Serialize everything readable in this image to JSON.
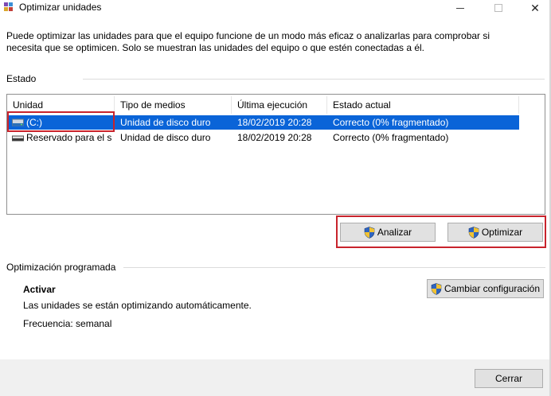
{
  "window": {
    "title": "Optimizar unidades"
  },
  "description": "Puede optimizar las unidades para que el equipo funcione de un modo más eficaz o analizarlas para comprobar si necesita que se optimicen. Solo se muestran las unidades del equipo o que estén conectadas a él.",
  "status": {
    "section_label": "Estado",
    "columns": [
      "Unidad",
      "Tipo de medios",
      "Última ejecución",
      "Estado actual"
    ],
    "rows": [
      {
        "unit": "(C:)",
        "media": "Unidad de disco duro",
        "last_run": "18/02/2019 20:28",
        "state": "Correcto (0% fragmentado)",
        "selected": true
      },
      {
        "unit": "Reservado para el s...",
        "media": "Unidad de disco duro",
        "last_run": "18/02/2019 20:28",
        "state": "Correcto (0% fragmentado)",
        "selected": false
      }
    ],
    "analyze_label": "Analizar",
    "optimize_label": "Optimizar"
  },
  "schedule": {
    "section_label": "Optimización programada",
    "activate_label": "Activar",
    "auto_text": "Las unidades se están optimizando automáticamente.",
    "frequency_text": "Frecuencia: semanal",
    "change_config_label": "Cambiar configuración"
  },
  "footer": {
    "close_label": "Cerrar"
  },
  "colors": {
    "selection": "#0a64d8",
    "highlight_annotation": "#c8232c",
    "button_face": "#e1e1e1"
  }
}
